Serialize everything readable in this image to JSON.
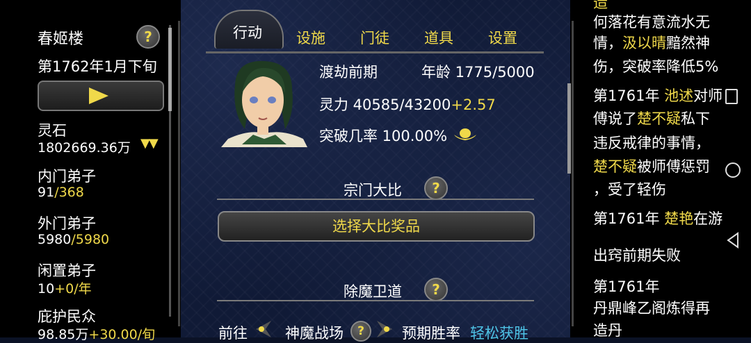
{
  "sidebar": {
    "title": "春姬楼",
    "date": "第1762年1月下旬",
    "stone_label": "灵石",
    "stone_value": "1802669.36万",
    "stone_arrows": "▼▼",
    "inner_label": "内门弟子",
    "inner_cur": "91",
    "inner_max": "/368",
    "outer_label": "外门弟子",
    "outer_cur": "5980",
    "outer_max": "/5980",
    "idle_label": "闲置弟子",
    "idle_cur": "10",
    "idle_rate": "+0/年",
    "people_label": "庇护民众",
    "people_cur": "98.85万",
    "people_rate": "+30.00/旬"
  },
  "tabs": {
    "active": "行动",
    "t1": "设施",
    "t2": "门徒",
    "t3": "道具",
    "t4": "设置"
  },
  "character": {
    "stage": "渡劫前期",
    "age": "年龄 1775/5000",
    "spirit": "灵力 40585/43200",
    "spirit_rate": "+2.57",
    "breakthrough": "突破几率 100.00%"
  },
  "sections": {
    "contest": "宗门大比",
    "contest_button": "选择大比奖品",
    "demon": "除魔卫道",
    "goto": "前往",
    "battlefield": "神魔战场",
    "win_rate_label": "预期胜率",
    "win_rate_value": "轻松获胜"
  },
  "log": {
    "l0a": "造",
    "l0b": "何落花有意流水无",
    "l0c": "情，",
    "l0d": "汲以晴",
    "l0e": "黯然神",
    "l0f": "伤，突破率降低5%",
    "l1a": "第1761年",
    "l1b": "池述",
    "l1c": "对师",
    "l1d": "傅说了",
    "l1e": "楚不疑",
    "l1f": "私下",
    "l1g": "违反戒律的事情，",
    "l1h": "楚不疑",
    "l1i": "被师傅惩罚",
    "l1j": "，受了轻伤",
    "l2a": "第1761年",
    "l2b": "楚艳",
    "l2c": "在游",
    "l2d": "出窍前期失败",
    "l3a": "第1761年",
    "l3b": "丹鼎峰乙阁炼得再",
    "l3c": "造丹"
  },
  "icons": {
    "help": "?"
  }
}
